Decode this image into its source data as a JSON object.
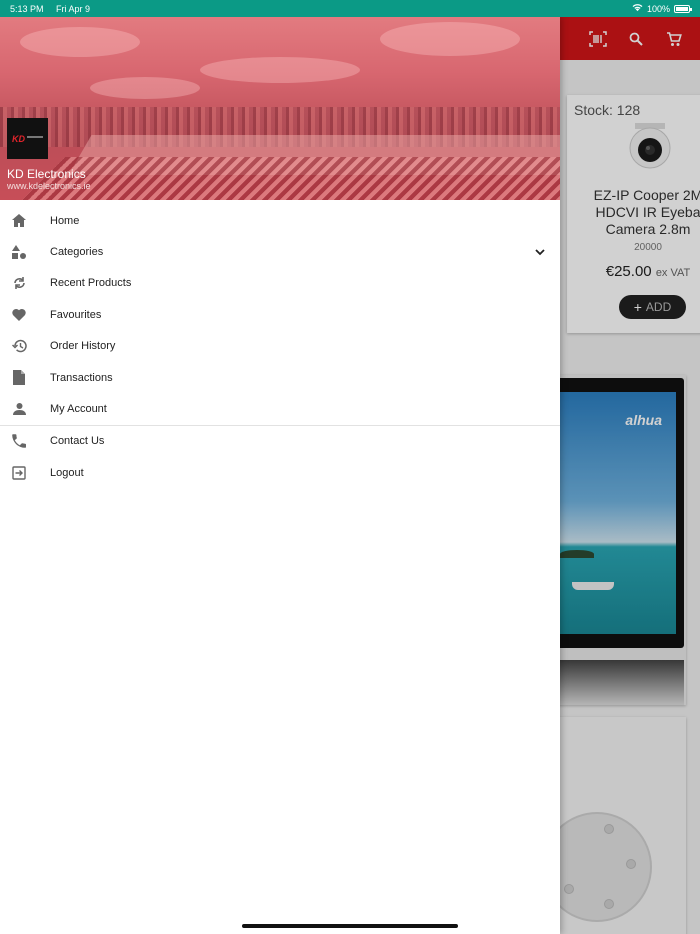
{
  "status_bar": {
    "time": "5:13 PM",
    "date": "Fri Apr 9",
    "battery": "100%",
    "battery_level": 1.0
  },
  "drawer": {
    "company_name": "KD Electronics",
    "website": "www.kdelectronics.ie",
    "menu": [
      {
        "label": "Home",
        "icon": "home-icon"
      },
      {
        "label": "Categories",
        "icon": "shapes-icon",
        "expandable": true
      },
      {
        "label": "Recent Products",
        "icon": "refresh-icon"
      },
      {
        "label": "Favourites",
        "icon": "heart-icon"
      },
      {
        "label": "Order History",
        "icon": "history-icon"
      },
      {
        "label": "Transactions",
        "icon": "document-icon"
      },
      {
        "label": "My Account",
        "icon": "person-icon"
      },
      {
        "label": "Contact Us",
        "icon": "phone-icon"
      },
      {
        "label": "Logout",
        "icon": "logout-icon"
      }
    ]
  },
  "background": {
    "product": {
      "stock": "Stock: 128",
      "name": "EZ-IP Cooper 2M HDCVI IR Eyeba Camera 2.8m",
      "code": "20000",
      "price": "€25.00",
      "vat": "ex VAT",
      "add_label": "ADD"
    },
    "monitor_brand": "alhua"
  },
  "colors": {
    "status_bar": "#0b9a86",
    "app_bar": "#d11518"
  }
}
